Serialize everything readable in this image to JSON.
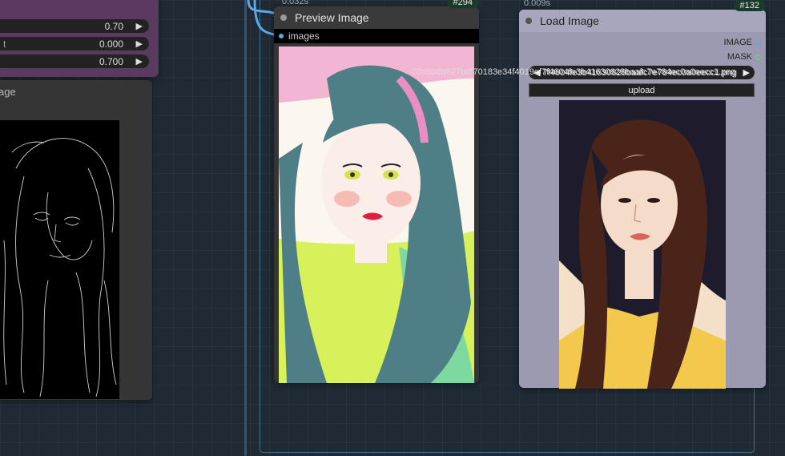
{
  "nodes": {
    "settings": {
      "widgets": [
        {
          "label": "",
          "value": "0.70"
        },
        {
          "label": "t",
          "value": "0.000"
        },
        {
          "label": "",
          "value": "0.700"
        }
      ],
      "arrow": "▶"
    },
    "left_image": {
      "title": "age"
    },
    "preview": {
      "title": "Preview Image",
      "input_label": "images",
      "timing": "0.032s",
      "badge": "#294"
    },
    "load_image": {
      "title": "Load Image",
      "timing": "0.009s",
      "badge": "#132",
      "outputs": [
        {
          "label": "IMAGE",
          "color": "#5aa8e8"
        },
        {
          "label": "MASK",
          "color": "#6cd46c"
        }
      ],
      "file_value": "7f4604fe3b41630828baafc7e784ec0a0eecc1.png",
      "file_arrow": "▶",
      "upload_label": "upload"
    }
  },
  "overlay_filename": "03d6b8b627bdf70183e34f4019ef7f4604fe3b41630828baafc7e784ec0a0eecc1.png",
  "colors": {
    "canvas": "#1f2a35",
    "settings_node": "#5b3a5f",
    "load_node": "#9c9ab0",
    "link": "#5aa8e8"
  }
}
